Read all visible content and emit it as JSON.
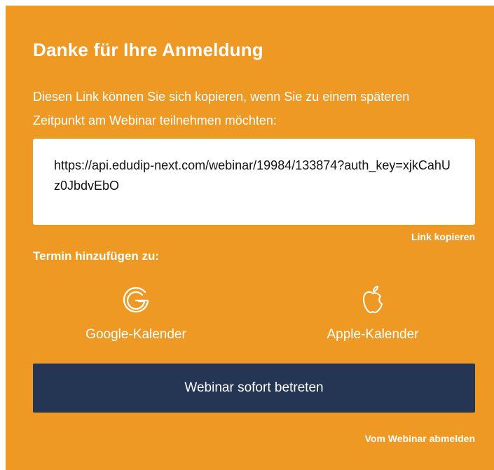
{
  "title": "Danke für Ihre Anmeldung",
  "intro": "Diesen Link können Sie sich kopieren, wenn Sie zu einem späteren Zeitpunkt am Webinar teilnehmen möchten:",
  "link": {
    "url": "https://api.edudip-next.com/webinar/19984/133874?auth_key=xjkCahUz0JbdvEbO",
    "copy_label": "Link kopieren"
  },
  "calendar": {
    "heading": "Termin hinzufügen zu:",
    "google": {
      "label": "Google-Kalender",
      "icon": "google-icon"
    },
    "apple": {
      "label": "Apple-Kalender",
      "icon": "apple-icon"
    }
  },
  "actions": {
    "enter_label": "Webinar sofort betreten",
    "unsubscribe_label": "Vom Webinar abmelden"
  },
  "colors": {
    "panel": "#ee9924",
    "button": "#243654",
    "text": "#ffffff"
  }
}
